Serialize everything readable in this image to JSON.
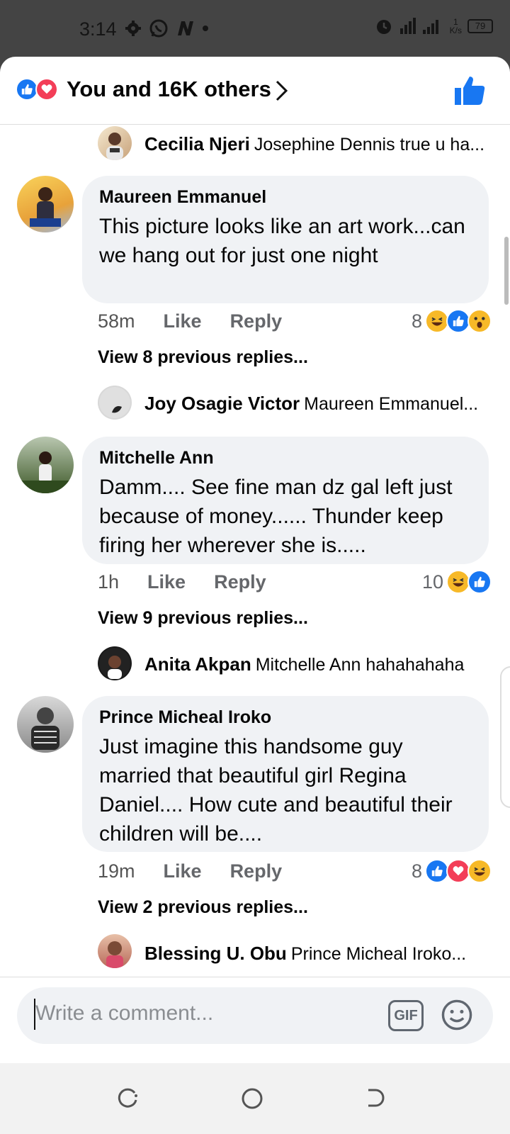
{
  "status_bar": {
    "time": "3:14",
    "network_speed_value": "1",
    "network_speed_unit": "K/s",
    "battery": "79",
    "icons": [
      "settings-gear-icon",
      "whatsapp-icon",
      "n-app-icon",
      "dot-icon",
      "alarm-icon",
      "signal-icon",
      "battery-icon"
    ]
  },
  "header": {
    "title": "You and 16K others",
    "reaction_icons": [
      "like-icon",
      "love-icon"
    ],
    "chevron_icon": "chevron-right-icon",
    "like_button_icon": "thumbs-up-icon"
  },
  "comments": [
    {
      "reply_preview": {
        "author": "Cecilia Njeri",
        "text": "Josephine Dennis true u ha..."
      }
    },
    {
      "author": "Maureen Emmanuel",
      "text": "This picture looks like an art work...can we hang out for just one night",
      "time": "58m",
      "like_label": "Like",
      "reply_label": "Reply",
      "reaction_count": "8",
      "reactions": [
        "haha",
        "like",
        "wow"
      ],
      "view_previous": "View 8 previous replies...",
      "reply_preview": {
        "author": "Joy Osagie Victor",
        "text": "Maureen Emmanuel..."
      }
    },
    {
      "author": "Mitchelle Ann",
      "text": "Damm.... See fine man dz gal left just because of money...... Thunder keep firing her wherever she is.....",
      "time": "1h",
      "like_label": "Like",
      "reply_label": "Reply",
      "reaction_count": "10",
      "reactions": [
        "haha",
        "like"
      ],
      "view_previous": "View 9 previous replies...",
      "reply_preview": {
        "author": "Anita Akpan",
        "text": "Mitchelle Ann hahahahaha"
      }
    },
    {
      "author": "Prince Micheal Iroko",
      "text": "Just imagine this handsome guy married that beautiful girl Regina Daniel.... How cute and beautiful their children will be....",
      "time": "19m",
      "like_label": "Like",
      "reply_label": "Reply",
      "reaction_count": "8",
      "reactions": [
        "like",
        "love",
        "haha"
      ],
      "view_previous": "View 2 previous replies...",
      "reply_preview": {
        "author": "Blessing U. Obu",
        "text": "Prince Micheal Iroko..."
      }
    }
  ],
  "composer": {
    "placeholder": "Write a comment...",
    "gif_label": "GIF",
    "emoji_icon": "emoji-icon"
  },
  "nav_bar": {
    "icons": [
      "recents-icon",
      "home-icon",
      "back-icon"
    ]
  },
  "colors": {
    "accent_blue": "#1877f2",
    "love_red": "#f33e58",
    "haha_yellow": "#f7b928",
    "bubble_gray": "#f0f2f5",
    "meta_gray": "#65676b"
  }
}
